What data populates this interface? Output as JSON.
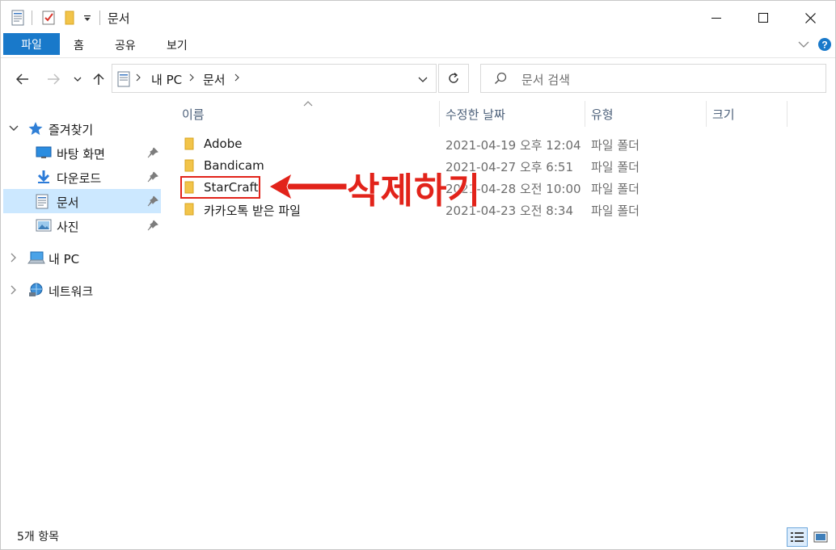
{
  "titlebar": {
    "title": "문서",
    "controls": {
      "minimize": "—",
      "maximize": "☐",
      "close": "✕"
    }
  },
  "ribbon": {
    "tabs": [
      {
        "label": "파일",
        "active": true
      },
      {
        "label": "홈"
      },
      {
        "label": "공유"
      },
      {
        "label": "보기"
      }
    ],
    "accent": "#1979ca"
  },
  "address": {
    "crumbs": [
      "내 PC",
      "문서"
    ],
    "separator": ">"
  },
  "search": {
    "placeholder": "문서 검색"
  },
  "sidebar": {
    "quick_access": {
      "label": "즐겨찾기",
      "icon": "star-icon"
    },
    "pinned": [
      {
        "label": "바탕 화면",
        "icon": "desktop-icon"
      },
      {
        "label": "다운로드",
        "icon": "download-icon"
      },
      {
        "label": "문서",
        "icon": "document-icon",
        "selected": true
      },
      {
        "label": "사진",
        "icon": "pictures-icon"
      }
    ],
    "this_pc": {
      "label": "내 PC",
      "icon": "computer-icon"
    },
    "network": {
      "label": "네트워크",
      "icon": "network-icon"
    }
  },
  "columns": {
    "name": "이름",
    "date": "수정한 날짜",
    "type": "유형",
    "size": "크기"
  },
  "files": [
    {
      "name": "Adobe",
      "date": "2021-04-19 오후 12:04",
      "type": "파일 폴더"
    },
    {
      "name": "Bandicam",
      "date": "2021-04-27 오후 6:51",
      "type": "파일 폴더"
    },
    {
      "name": "StarCraft",
      "date": "2021-04-28 오전 10:00",
      "type": "파일 폴더"
    },
    {
      "name": "카카오톡 받은 파일",
      "date": "2021-04-23 오전 8:34",
      "type": "파일 폴더"
    }
  ],
  "annotation": {
    "text": "삭제하기",
    "color": "#e2231a"
  },
  "status": {
    "count": "5개 항목"
  }
}
